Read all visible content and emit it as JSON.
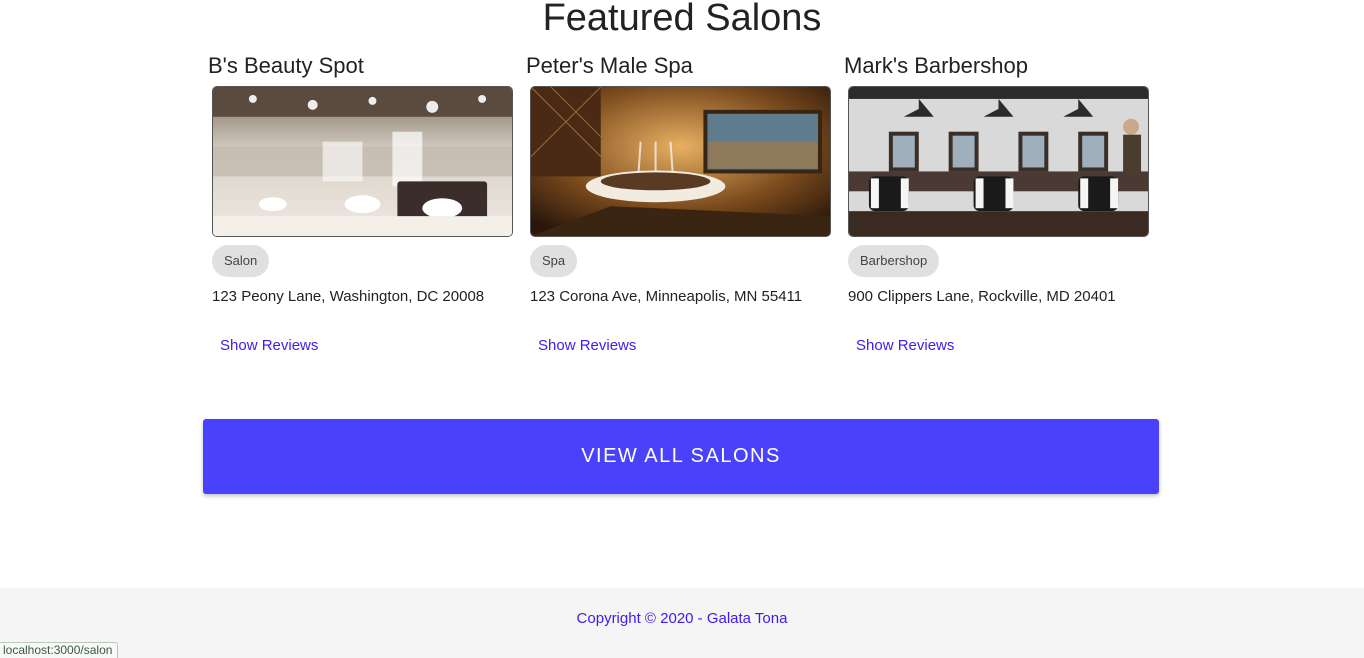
{
  "page": {
    "heading": "Featured Salons"
  },
  "salons": [
    {
      "name": "B's Beauty Spot",
      "category": "Salon",
      "address": "123 Peony Lane, Washington, DC 20008",
      "link": "Show Reviews",
      "image_icon": "salon-interior-photo"
    },
    {
      "name": "Peter's Male Spa",
      "category": "Spa",
      "address": "123 Corona Ave, Minneapolis, MN 55411",
      "link": "Show Reviews",
      "image_icon": "spa-treatment-photo"
    },
    {
      "name": "Mark's Barbershop",
      "category": "Barbershop",
      "address": "900 Clippers Lane, Rockville, MD 20401",
      "link": "Show Reviews",
      "image_icon": "barbershop-interior-photo"
    }
  ],
  "actions": {
    "view_all_label": "VIEW ALL SALONS"
  },
  "footer": {
    "copyright": "Copyright © 2020 - Galata Tona"
  },
  "status_bar": {
    "url": "localhost:3000/salon"
  },
  "colors": {
    "primary": "#4a42fb",
    "link": "#3a1df0",
    "chip": "#e0e0e0",
    "footer_bg": "#f5f5f5"
  }
}
